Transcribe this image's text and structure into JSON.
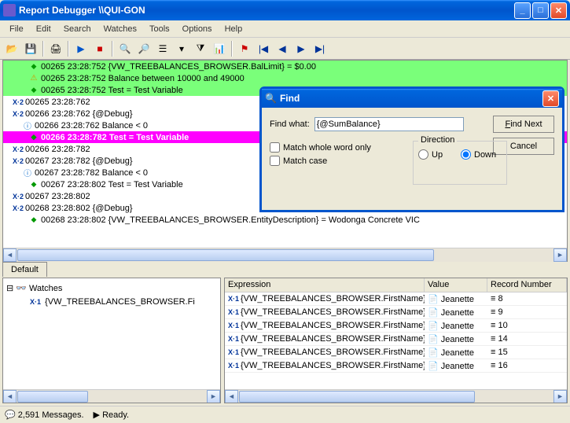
{
  "window": {
    "title": "Report Debugger  \\\\QUI-GON"
  },
  "menu": [
    "File",
    "Edit",
    "Search",
    "Watches",
    "Tools",
    "Options",
    "Help"
  ],
  "log": [
    {
      "cls": "green indent1",
      "ico": "diam",
      "text": "00265  23:28:752  {VW_TREEBALANCES_BROWSER.BalLimit} = $0.00"
    },
    {
      "cls": "green indent1",
      "ico": "warn",
      "text": "00265  23:28:752  Balance between 10000 and 49000"
    },
    {
      "cls": "green indent1",
      "ico": "diam",
      "text": "00265  23:28:752  Test = Test Variable"
    },
    {
      "cls": "indent0",
      "ico": "x2",
      "text": "00265  23:28:762"
    },
    {
      "cls": "indent0",
      "ico": "x2",
      "text": "00266  23:28:762  {@Debug}"
    },
    {
      "cls": "indent2",
      "ico": "info",
      "text": "00266  23:28:762  Balance < 0"
    },
    {
      "cls": "magenta indent1",
      "ico": "diam",
      "text": "00266  23:28:782  Test = Test Variable"
    },
    {
      "cls": "indent0",
      "ico": "x2",
      "text": "00266  23:28:782"
    },
    {
      "cls": "indent0",
      "ico": "x2",
      "text": "00267  23:28:782  {@Debug}"
    },
    {
      "cls": "indent2",
      "ico": "info",
      "text": "00267  23:28:782  Balance < 0"
    },
    {
      "cls": "indent1",
      "ico": "diam",
      "text": "00267  23:28:802  Test = Test Variable"
    },
    {
      "cls": "indent0",
      "ico": "x2",
      "text": "00267  23:28:802"
    },
    {
      "cls": "indent0",
      "ico": "x2",
      "text": "00268  23:28:802  {@Debug}"
    },
    {
      "cls": "indent1",
      "ico": "diam",
      "text": "00268  23:28:802  {VW_TREEBALANCES_BROWSER.EntityDescription} = Wodonga Concrete  VIC"
    }
  ],
  "tab": "Default",
  "tree": {
    "root": "Watches",
    "child": "{VW_TREEBALANCES_BROWSER.Fi"
  },
  "grid": {
    "cols": [
      "Expression",
      "Value",
      "Record Number"
    ],
    "rows": [
      {
        "e": "{VW_TREEBALANCES_BROWSER.FirstName} Like e",
        "v": "Jeanette",
        "r": "8"
      },
      {
        "e": "{VW_TREEBALANCES_BROWSER.FirstName} Like e",
        "v": "Jeanette",
        "r": "9"
      },
      {
        "e": "{VW_TREEBALANCES_BROWSER.FirstName} Like e",
        "v": "Jeanette",
        "r": "10"
      },
      {
        "e": "{VW_TREEBALANCES_BROWSER.FirstName} Like e",
        "v": "Jeanette",
        "r": "14"
      },
      {
        "e": "{VW_TREEBALANCES_BROWSER.FirstName} Like e",
        "v": "Jeanette",
        "r": "15"
      },
      {
        "e": "{VW_TREEBALANCES_BROWSER.FirstName} Like e",
        "v": "Jeanette",
        "r": "16"
      }
    ]
  },
  "find": {
    "title": "Find",
    "label_what": "Find what:",
    "value": "{@SumBalance}",
    "whole_word": "Match whole word only",
    "match_case": "Match case",
    "direction": "Direction",
    "up": "Up",
    "down": "Down",
    "find_next": "Find Next",
    "cancel": "Cancel"
  },
  "status": {
    "messages": "2,591 Messages.",
    "ready": "Ready."
  }
}
